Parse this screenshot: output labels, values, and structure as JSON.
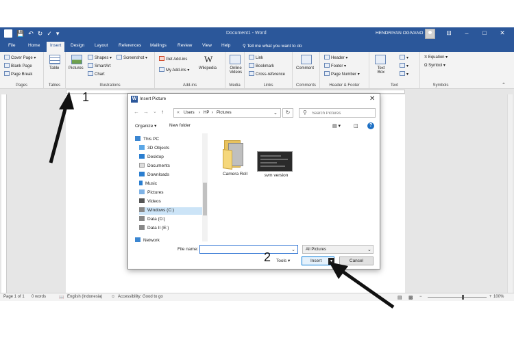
{
  "app": {
    "doc_title": "Document1  -  Word",
    "user_name": "HENDRIYAN OGIVANO",
    "brand_color": "#2b579a",
    "window_controls": [
      "⊟",
      "–",
      "□",
      "✕"
    ]
  },
  "tabs": [
    "File",
    "Home",
    "Insert",
    "Design",
    "Layout",
    "References",
    "Mailings",
    "Review",
    "View",
    "Help"
  ],
  "active_tab": "Insert",
  "tell_me": "Tell me what you want to do",
  "ribbon": {
    "pages": {
      "items": [
        "Cover Page",
        "Blank Page",
        "Page Break"
      ],
      "label": "Pages"
    },
    "tables": {
      "items": [
        "Table"
      ],
      "label": "Tables"
    },
    "illustrations": {
      "pictures": "Pictures",
      "shapes": "Shapes",
      "smartart": "SmartArt",
      "chart": "Chart",
      "screenshot": "Screenshot",
      "label": "Illustrations"
    },
    "addins": {
      "get": "Get Add-ins",
      "my": "My Add-ins",
      "wikipedia": "Wikipedia",
      "label": "Add-ins"
    },
    "media": {
      "online_videos": "Online Videos",
      "label": "Media"
    },
    "links": {
      "link": "Link",
      "bookmark": "Bookmark",
      "cross_reference": "Cross-reference",
      "label": "Links"
    },
    "comments": {
      "comment": "Comment",
      "label": "Comments"
    },
    "header_footer": {
      "header": "Header",
      "footer": "Footer",
      "page_number": "Page Number",
      "label": "Header & Footer"
    },
    "text": {
      "text_box": "Text Box",
      "label": "Text"
    },
    "symbols": {
      "equation": "Equation",
      "symbol": "Symbol",
      "label": "Symbols"
    }
  },
  "status": {
    "page": "Page 1 of 1",
    "words": "0 words",
    "language": "English (Indonesia)",
    "accessibility": "Accessibility: Good to go",
    "zoom": "100%",
    "zoom_minus": "−",
    "zoom_plus": "+",
    "zoom_level": 1.0
  },
  "dialog": {
    "title": "Insert Picture",
    "close": "✕",
    "nav_back": "←",
    "nav_forward": "→",
    "nav_recent": "⌄",
    "nav_up": "↑",
    "path": [
      "Users",
      "HP",
      "Pictures"
    ],
    "path_sep": "›",
    "search_placeholder": "Search Pictures",
    "organize": "Organize ▾",
    "new_folder": "New folder",
    "help": "?",
    "tree": [
      "This PC",
      "3D Objects",
      "Desktop",
      "Documents",
      "Downloads",
      "Music",
      "Pictures",
      "Videos",
      "Windows (C:)",
      "Data (D:)",
      "Data II (E:)",
      "Network"
    ],
    "selected_tree_item": "Windows (C:)",
    "files": [
      "Camera Roll",
      "svm version"
    ],
    "file_name_label": "File name:",
    "file_name_value": "",
    "filter": "All Pictures",
    "tools": "Tools",
    "insert": "Insert",
    "cancel": "Cancel"
  },
  "annotations": [
    "1",
    "2"
  ]
}
